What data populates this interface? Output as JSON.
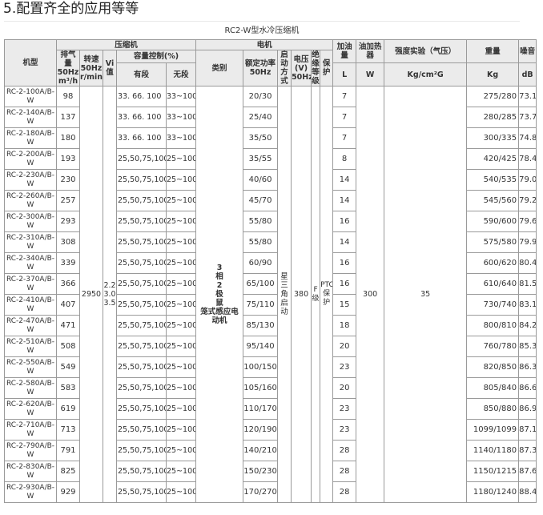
{
  "heading": "5.配置齐全的应用等等",
  "caption": "RC2-W型水冷压缩机",
  "headers": {
    "model": "机型",
    "compressor": "压缩机",
    "motor": "电机",
    "displacement": "排气量",
    "displacement_freq": "50Hz",
    "displacement_unit": "m³/h",
    "speed": "转速",
    "speed_freq": "50Hz",
    "speed_unit": "r/min",
    "vi": "Vi值",
    "capacity": "容量控制(%)",
    "stepped": "有段",
    "stepless": "无段",
    "category": "类别",
    "rated_power": "额定功率",
    "rated_power_freq": "50Hz",
    "start": "启动方式",
    "voltage": "电压(V)",
    "voltage_freq": "50Hz",
    "insulation": "绝缘等级",
    "protection": "保护",
    "oil_charge": "加油量",
    "oil_heater": "油加热器",
    "strength_test": "强度实验（气压）",
    "weight": "重量",
    "noise": "噪音",
    "oil_charge_unit": "L",
    "oil_heater_unit": "W",
    "strength_test_unit": "Kg/cm²G",
    "weight_unit": "Kg",
    "noise_unit": "dB"
  },
  "shared": {
    "speed": "2950",
    "vi": [
      "2.2",
      "3.0",
      "3.5"
    ],
    "category": [
      "3",
      "相",
      "2",
      "极",
      "鼠",
      "笼式感应电",
      "动机"
    ],
    "start": "星三角启动",
    "voltage": "380",
    "insulation": "F级",
    "protection": "PTC保护",
    "oil_heater": "300",
    "strength_test": "35"
  },
  "rows": [
    {
      "model": "RC-2-100A/B-W",
      "displacement": "98",
      "stepped": "33. 66. 100",
      "stepless": "33~100",
      "power": "20/30",
      "oil": "7",
      "weight": "275/280",
      "noise": "73.1"
    },
    {
      "model": "RC-2-140A/B-W",
      "displacement": "137",
      "stepped": "33. 66. 100",
      "stepless": "33~100",
      "power": "25/40",
      "oil": "7",
      "weight": "280/285",
      "noise": "73.7"
    },
    {
      "model": "RC-2-180A/B-W",
      "displacement": "180",
      "stepped": "33. 66. 100",
      "stepless": "33~100",
      "power": "35/50",
      "oil": "7",
      "weight": "300/335",
      "noise": "74.8"
    },
    {
      "model": "RC-2-200A/B-W",
      "displacement": "193",
      "stepped": "25,50,75,100",
      "stepless": "25~100",
      "power": "35/55",
      "oil": "8",
      "weight": "420/425",
      "noise": "78.4"
    },
    {
      "model": "RC-2-230A/B-W",
      "displacement": "230",
      "stepped": "25,50,75,100",
      "stepless": "25~100",
      "power": "40/60",
      "oil": "14",
      "weight": "540/535",
      "noise": "79.0"
    },
    {
      "model": "RC-2-260A/B-W",
      "displacement": "257",
      "stepped": "25,50,75,100",
      "stepless": "25~100",
      "power": "45/70",
      "oil": "14",
      "weight": "545/560",
      "noise": "79.2"
    },
    {
      "model": "RC-2-300A/B-W",
      "displacement": "293",
      "stepped": "25,50,75,100",
      "stepless": "25~100",
      "power": "55/80",
      "oil": "16",
      "weight": "590/600",
      "noise": "79.6"
    },
    {
      "model": "RC-2-310A/B-W",
      "displacement": "308",
      "stepped": "25,50,75,100",
      "stepless": "25~100",
      "power": "55/80",
      "oil": "14",
      "weight": "575/580",
      "noise": "79.9"
    },
    {
      "model": "RC-2-340A/B-W",
      "displacement": "339",
      "stepped": "25,50,75,100",
      "stepless": "25~100",
      "power": "60/90",
      "oil": "16",
      "weight": "600/620",
      "noise": "80.4"
    },
    {
      "model": "RC-2-370A/B-W",
      "displacement": "366",
      "stepped": "25,50,75,100",
      "stepless": "25~100",
      "power": "65/100",
      "oil": "16",
      "weight": "610/640",
      "noise": "81.5"
    },
    {
      "model": "RC-2-410A/B-W",
      "displacement": "407",
      "stepped": "25,50,75,100",
      "stepless": "25~100",
      "power": "75/110",
      "oil": "15",
      "weight": "730/740",
      "noise": "83.1"
    },
    {
      "model": "RC-2-470A/B-W",
      "displacement": "471",
      "stepped": "25,50,75,100",
      "stepless": "25~100",
      "power": "85/130",
      "oil": "18",
      "weight": "800/810",
      "noise": "84.2"
    },
    {
      "model": "RC-2-510A/B-W",
      "displacement": "508",
      "stepped": "25,50,75,100",
      "stepless": "25~100",
      "power": "95/140",
      "oil": "20",
      "weight": "760/780",
      "noise": "85.3"
    },
    {
      "model": "RC-2-550A/B-W",
      "displacement": "549",
      "stepped": "25,50,75,100",
      "stepless": "25~100",
      "power": "100/150",
      "oil": "23",
      "weight": "820/850",
      "noise": "86.3"
    },
    {
      "model": "RC-2-580A/B-W",
      "displacement": "583",
      "stepped": "25,50,75,100",
      "stepless": "25~100",
      "power": "105/160",
      "oil": "20",
      "weight": "805/840",
      "noise": "86.6"
    },
    {
      "model": "RC-2-620A/B-W",
      "displacement": "619",
      "stepped": "25,50,75,100",
      "stepless": "25~100",
      "power": "110/170",
      "oil": "23",
      "weight": "850/880",
      "noise": "86.9"
    },
    {
      "model": "RC-2-710A/B-W",
      "displacement": "713",
      "stepped": "25,50,75,100",
      "stepless": "25~100",
      "power": "120/190",
      "oil": "23",
      "weight": "1099/1099",
      "noise": "87.1"
    },
    {
      "model": "RC-2-790A/B-W",
      "displacement": "791",
      "stepped": "25,50,75,100",
      "stepless": "25~100",
      "power": "140/210",
      "oil": "28",
      "weight": "1140/1180",
      "noise": "87.3"
    },
    {
      "model": "RC-2-830A/B-W",
      "displacement": "825",
      "stepped": "25,50,75,100",
      "stepless": "25~100",
      "power": "150/230",
      "oil": "28",
      "weight": "1150/1215",
      "noise": "87.6"
    },
    {
      "model": "RC-2-930A/B-W",
      "displacement": "929",
      "stepped": "25,50,75,100",
      "stepless": "25~100",
      "power": "170/270",
      "oil": "28",
      "weight": "1180/1240",
      "noise": "88.4"
    }
  ]
}
